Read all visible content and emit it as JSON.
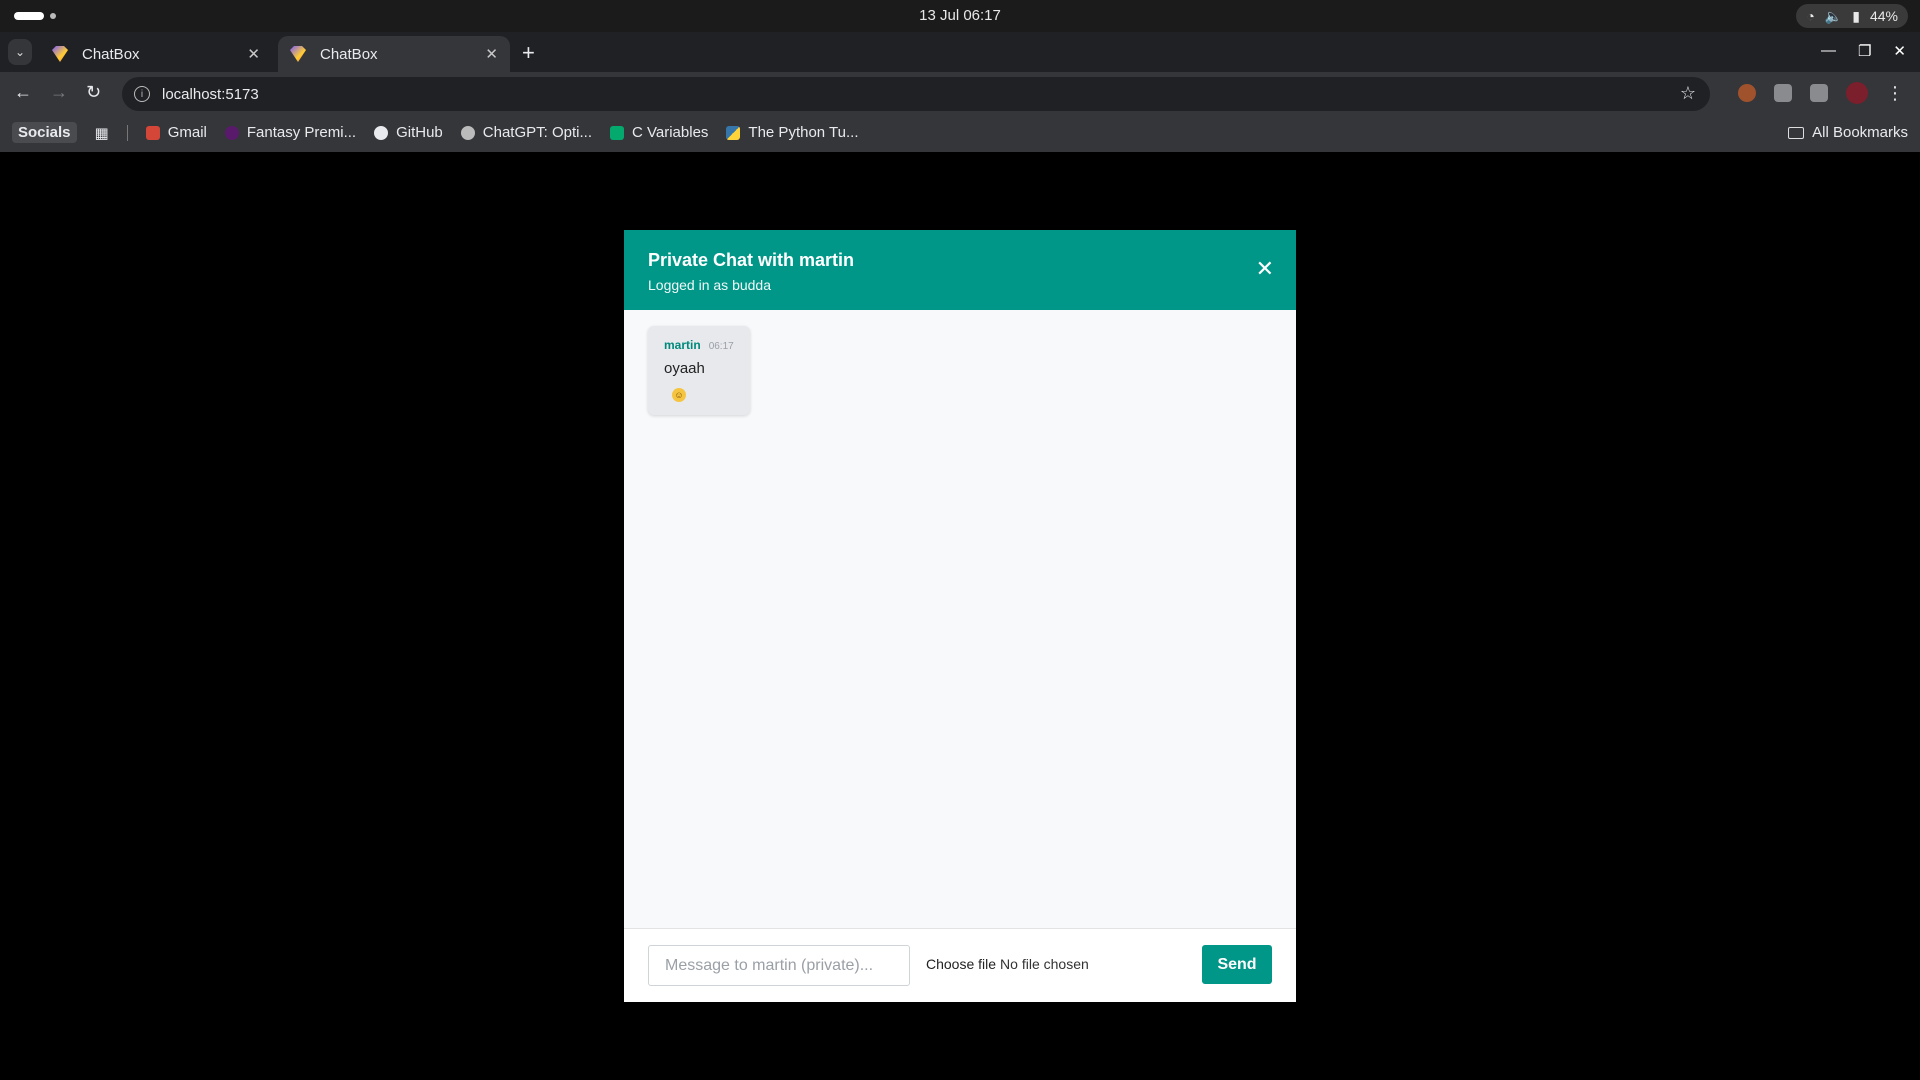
{
  "os": {
    "clock": "13 Jul  06:17",
    "battery": "44%"
  },
  "browser": {
    "tabs": [
      {
        "label": "ChatBox",
        "active": false
      },
      {
        "label": "ChatBox",
        "active": true
      }
    ],
    "url": "localhost:5173",
    "bookmarks": [
      {
        "label": "Socials",
        "icon": "folder-icon"
      },
      {
        "label": "Gmail",
        "icon": "gmail-icon"
      },
      {
        "label": "Fantasy Premi...",
        "icon": "fpl-icon"
      },
      {
        "label": "GitHub",
        "icon": "github-icon"
      },
      {
        "label": "ChatGPT: Opti...",
        "icon": "chatgpt-icon"
      },
      {
        "label": "C Variables",
        "icon": "w3schools-icon"
      },
      {
        "label": "The Python Tu...",
        "icon": "python-icon"
      }
    ],
    "all_bookmarks": "All Bookmarks"
  },
  "chat": {
    "title": "Private Chat with martin",
    "subtitle": "Logged in as budda",
    "close_symbol": "✕",
    "messages": [
      {
        "sender": "martin",
        "time": "06:17",
        "text": "oyaah",
        "emoji": "😊"
      }
    ],
    "input_placeholder": "Message to martin (private)...",
    "file_button": "Choose file",
    "file_status": "No file chosen",
    "send_label": "Send"
  },
  "colors": {
    "accent": "#009688",
    "sender": "#00897b"
  }
}
